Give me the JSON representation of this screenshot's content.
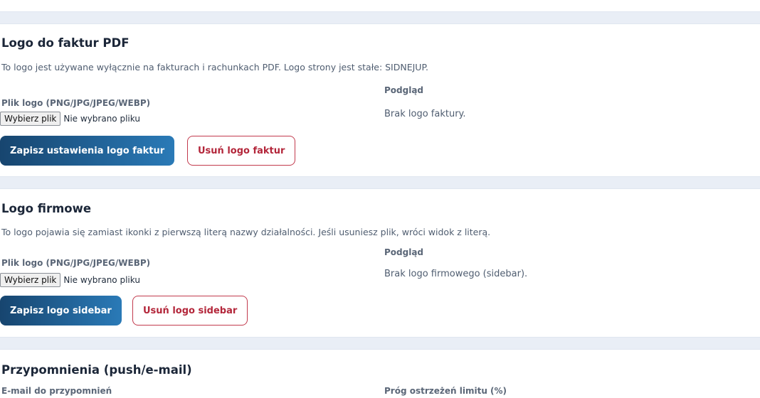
{
  "invoice_logo": {
    "title": "Logo do faktur PDF",
    "description": "To logo jest używane wyłącznie na fakturach i rachunkach PDF. Logo strony jest stałe: SIDNEJUP.",
    "file_label": "Plik logo (PNG/JPG/JPEG/WEBP)",
    "file_button": "Wybierz plik",
    "file_status": "Nie wybrano pliku",
    "preview_label": "Podgląd",
    "preview_text": "Brak logo faktury.",
    "save_label": "Zapisz ustawienia logo faktur",
    "remove_label": "Usuń logo faktur"
  },
  "company_logo": {
    "title": "Logo firmowe",
    "description": "To logo pojawia się zamiast ikonki z pierwszą literą nazwy działalności. Jeśli usuniesz plik, wróci widok z literą.",
    "file_label": "Plik logo (PNG/JPG/JPEG/WEBP)",
    "file_button": "Wybierz plik",
    "file_status": "Nie wybrano pliku",
    "preview_label": "Podgląd",
    "preview_text": "Brak logo firmowego (sidebar).",
    "save_label": "Zapisz logo sidebar",
    "remove_label": "Usuń logo sidebar"
  },
  "reminders": {
    "title": "Przypomnienia (push/e-mail)",
    "email_label": "E-mail do przypomnień",
    "threshold_label": "Próg ostrzeżeń limitu (%)"
  },
  "colors": {
    "primary_gradient_start": "#17456f",
    "primary_gradient_end": "#2a7ab7",
    "danger": "#b3263a",
    "band": "#e9eef6"
  }
}
